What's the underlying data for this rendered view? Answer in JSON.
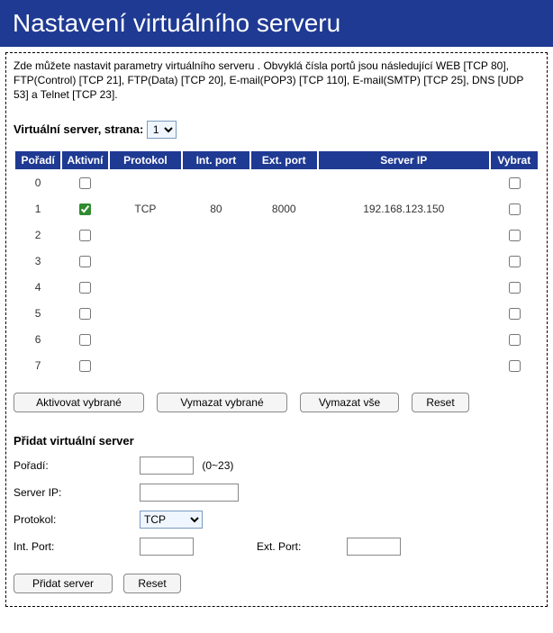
{
  "title": "Nastavení virtuálního serveru",
  "description": "Zde můžete nastavit parametry virtuálního serveru . Obvyklá čísla portů jsou následující WEB [TCP 80], FTP(Control) [TCP 21], FTP(Data) [TCP 20], E-mail(POP3) [TCP 110], E-mail(SMTP) [TCP 25], DNS [UDP 53] a Telnet [TCP 23].",
  "page_select": {
    "label": "Virtuální server, strana:",
    "value": "1"
  },
  "table": {
    "headers": {
      "order": "Pořadí",
      "active": "Aktivní",
      "protocol": "Protokol",
      "int_port": "Int. port",
      "ext_port": "Ext. port",
      "server_ip": "Server IP",
      "select": "Vybrat"
    },
    "rows": [
      {
        "index": "0",
        "active": false,
        "protocol": "",
        "int_port": "",
        "ext_port": "",
        "server_ip": "",
        "selected": false
      },
      {
        "index": "1",
        "active": true,
        "protocol": "TCP",
        "int_port": "80",
        "ext_port": "8000",
        "server_ip": "192.168.123.150",
        "selected": false
      },
      {
        "index": "2",
        "active": false,
        "protocol": "",
        "int_port": "",
        "ext_port": "",
        "server_ip": "",
        "selected": false
      },
      {
        "index": "3",
        "active": false,
        "protocol": "",
        "int_port": "",
        "ext_port": "",
        "server_ip": "",
        "selected": false
      },
      {
        "index": "4",
        "active": false,
        "protocol": "",
        "int_port": "",
        "ext_port": "",
        "server_ip": "",
        "selected": false
      },
      {
        "index": "5",
        "active": false,
        "protocol": "",
        "int_port": "",
        "ext_port": "",
        "server_ip": "",
        "selected": false
      },
      {
        "index": "6",
        "active": false,
        "protocol": "",
        "int_port": "",
        "ext_port": "",
        "server_ip": "",
        "selected": false
      },
      {
        "index": "7",
        "active": false,
        "protocol": "",
        "int_port": "",
        "ext_port": "",
        "server_ip": "",
        "selected": false
      }
    ]
  },
  "buttons": {
    "activate": "Aktivovat vybrané",
    "clear_selected": "Vymazat vybrané",
    "clear_all": "Vymazat vše",
    "reset": "Reset",
    "add_server": "Přidat server",
    "reset2": "Reset"
  },
  "add_form": {
    "title": "Přidat virtuální server",
    "order_label": "Pořadí:",
    "order_value": "",
    "order_hint": "(0~23)",
    "ip_label": "Server IP:",
    "ip_value": "",
    "protocol_label": "Protokol:",
    "protocol_value": "TCP",
    "int_port_label": "Int. Port:",
    "int_port_value": "",
    "ext_port_label": "Ext. Port:",
    "ext_port_value": ""
  }
}
